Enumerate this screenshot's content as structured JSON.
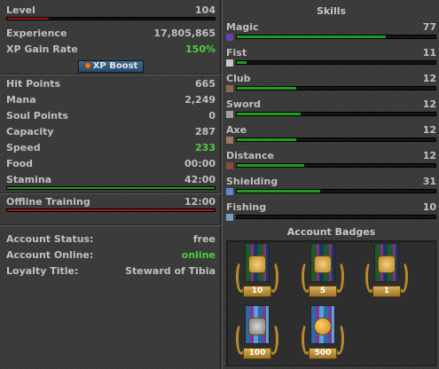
{
  "stats": {
    "level": {
      "label": "Level",
      "value": "104",
      "progress": 0.2
    },
    "experience": {
      "label": "Experience",
      "value": "17,805,865"
    },
    "xp_gain_rate": {
      "label": "XP Gain Rate",
      "value": "150%"
    },
    "xp_boost_button": "XP Boost",
    "hit_points": {
      "label": "Hit Points",
      "value": "665"
    },
    "mana": {
      "label": "Mana",
      "value": "2,249"
    },
    "soul_points": {
      "label": "Soul Points",
      "value": "0"
    },
    "capacity": {
      "label": "Capacity",
      "value": "287"
    },
    "speed": {
      "label": "Speed",
      "value": "233"
    },
    "food": {
      "label": "Food",
      "value": "00:00"
    },
    "stamina": {
      "label": "Stamina",
      "value": "42:00",
      "progress": 1.0
    },
    "offline_training": {
      "label": "Offline Training",
      "value": "12:00",
      "progress": 1.0
    }
  },
  "account": {
    "status": {
      "label": "Account Status:",
      "value": "free"
    },
    "online": {
      "label": "Account Online:",
      "value": "online"
    },
    "loyalty": {
      "label": "Loyalty Title:",
      "value": "Steward of Tibia"
    }
  },
  "skills": {
    "title": "Skills",
    "items": [
      {
        "name": "Magic",
        "value": "77",
        "progress": 0.75,
        "icon": "magic-icon"
      },
      {
        "name": "Fist",
        "value": "11",
        "progress": 0.05,
        "icon": "fist-icon"
      },
      {
        "name": "Club",
        "value": "12",
        "progress": 0.3,
        "icon": "club-icon"
      },
      {
        "name": "Sword",
        "value": "12",
        "progress": 0.32,
        "icon": "sword-icon"
      },
      {
        "name": "Axe",
        "value": "12",
        "progress": 0.3,
        "icon": "axe-icon"
      },
      {
        "name": "Distance",
        "value": "12",
        "progress": 0.34,
        "icon": "distance-icon"
      },
      {
        "name": "Shielding",
        "value": "31",
        "progress": 0.42,
        "icon": "shield-icon"
      },
      {
        "name": "Fishing",
        "value": "10",
        "progress": 0.0,
        "icon": "fishing-icon"
      }
    ]
  },
  "badges": {
    "title": "Account Badges",
    "items": [
      {
        "label": "10",
        "style": "gb",
        "emblem": "gold"
      },
      {
        "label": "5",
        "style": "gb",
        "emblem": "gold"
      },
      {
        "label": "1",
        "style": "gb",
        "emblem": "gold"
      },
      {
        "label": "100",
        "style": "bp",
        "emblem": "gray"
      },
      {
        "label": "500",
        "style": "bp",
        "emblem": "coin"
      }
    ]
  },
  "colors": {
    "accent_green": "#4ecf3c",
    "bar_red": "#a8151a",
    "bar_green": "#1f9e1f"
  }
}
